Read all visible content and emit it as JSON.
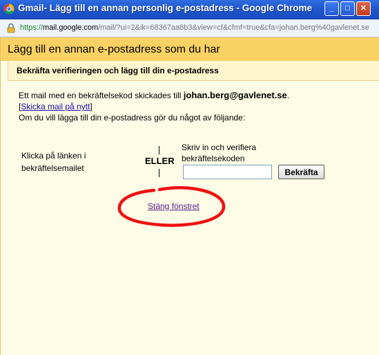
{
  "window": {
    "title": "Gmail- Lägg till en annan personlig e-postadress - Google Chrome",
    "min_glyph": "_",
    "max_glyph": "□",
    "close_glyph": "✕"
  },
  "address": {
    "scheme": "https://",
    "host": "mail.google.com",
    "path": "/mail/?ui=2&ik=68367aa8b3&view=cf&cfmf=true&cfa=johan.berg%40gavlenet.se"
  },
  "dialog": {
    "title": "Lägg till en annan e-postadress som du har",
    "subtitle": "Bekräfta verifieringen och lägg till din e-postadress",
    "sent_text": "Ett mail med en bekräftelsekod skickades till ",
    "email": "johan.berg@gavlenet.se",
    "sent_period": ".",
    "bracket_open": "[",
    "resend_link": "Skicka mail på nytt",
    "bracket_close": "]",
    "instruction": "Om du vill lägga till din e-postadress gör du något av följande:",
    "option_left": "Klicka på länken i bekräftelsemailet",
    "or_label": "ELLER",
    "option_right": "Skriv in och verifiera bekräftelsekoden",
    "code_value": "",
    "confirm_button": "Bekräfta",
    "close_link": "Stäng fönstret"
  },
  "colors": {
    "header_bg": "#fad163",
    "page_bg": "#fefbe6",
    "annotation": "#ee1111"
  }
}
